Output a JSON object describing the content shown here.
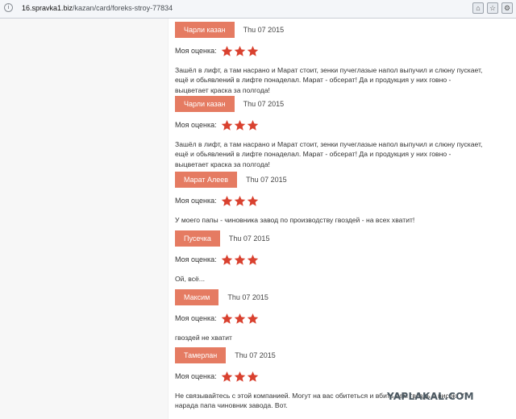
{
  "browser": {
    "url_host": "16.spravka1.biz",
    "url_path": "/kazan/card/foreks-stroy-77834"
  },
  "rating_label": "Моя оценка:",
  "reviews": [
    {
      "author": "Чарли казан",
      "date": "Thu 07 2015",
      "stars": 3,
      "text": "Зашёл в лифт, а там насрано и Марат стоит, зенки пучеглазые напол выпучил и слюну пускает, ещё и обьявлений в лифте понаделал. Марат - обсерат! Да и продукция у них говно - выцветает краска за полгода!"
    },
    {
      "author": "Чарли казан",
      "date": "Thu 07 2015",
      "stars": 3,
      "text": "Зашёл в лифт, а там насрано и Марат стоит, зенки пучеглазые напол выпучил и слюну пускает, ещё и обьявлений в лифте понаделал. Марат - обсерат! Да и продукция у них говно - выцветает краска за полгода!"
    },
    {
      "author": "Марат Алеев",
      "date": "Thu 07 2015",
      "stars": 3,
      "text": "У моего папы - чиновника завод по производству гвоздей - на всех хватит!"
    },
    {
      "author": "Пусечка",
      "date": "Thu 07 2015",
      "stars": 3,
      "text": "Ой, всё..."
    },
    {
      "author": "Максим",
      "date": "Thu 07 2015",
      "stars": 3,
      "text": "гвоздей не хватит"
    },
    {
      "author": "Тамерлан",
      "date": "Thu 07 2015",
      "stars": 3,
      "text": "Не связывайтесь с этой компанией. Могут на вас обитеться и вбить вам гвоздь в висок. У нарада папа чиновник завода. Вот."
    }
  ],
  "watermark": "YAPLAKAL.COM",
  "colors": {
    "author_badge": "#e57b62",
    "star": "#d9412f"
  }
}
